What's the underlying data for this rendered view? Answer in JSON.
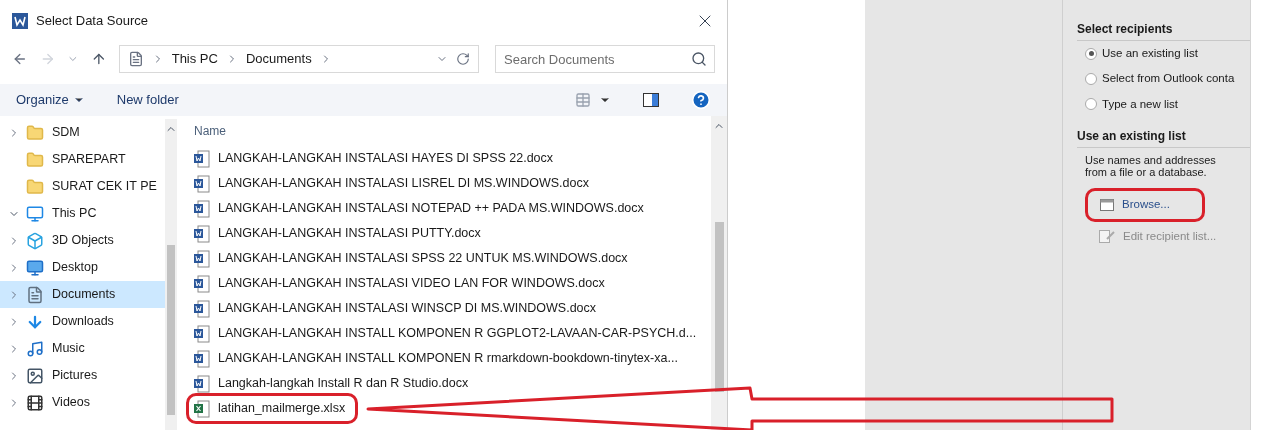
{
  "dialog": {
    "title": "Select Data Source",
    "breadcrumb": [
      "This PC",
      "Documents"
    ],
    "search": {
      "placeholder": "Search Documents"
    },
    "toolbar": {
      "organize": "Organize",
      "new_folder": "New folder"
    },
    "sidebar": [
      {
        "label": "SDM",
        "kind": "folder",
        "expandable": true,
        "selected": false
      },
      {
        "label": "SPAREPART",
        "kind": "folder",
        "expandable": false,
        "selected": false
      },
      {
        "label": "SURAT CEK IT PE",
        "kind": "folder",
        "expandable": false,
        "selected": false
      },
      {
        "label": "This PC",
        "kind": "pc",
        "expandable": true,
        "expanded": true,
        "selected": false,
        "children": [
          {
            "label": "3D Objects",
            "kind": "cube",
            "expandable": true,
            "selected": false
          },
          {
            "label": "Desktop",
            "kind": "desktop",
            "expandable": true,
            "selected": false
          },
          {
            "label": "Documents",
            "kind": "document",
            "expandable": true,
            "selected": true
          },
          {
            "label": "Downloads",
            "kind": "download",
            "expandable": true,
            "selected": false
          },
          {
            "label": "Music",
            "kind": "music",
            "expandable": true,
            "selected": false
          },
          {
            "label": "Pictures",
            "kind": "picture",
            "expandable": true,
            "selected": false
          },
          {
            "label": "Videos",
            "kind": "video",
            "expandable": true,
            "selected": false
          }
        ]
      }
    ],
    "column": "Name",
    "files": [
      {
        "name": "LANGKAH-LANGKAH INSTALASI HAYES DI SPSS 22.docx",
        "kind": "word"
      },
      {
        "name": "LANGKAH-LANGKAH INSTALASI LISREL DI MS.WINDOWS.docx",
        "kind": "word"
      },
      {
        "name": "LANGKAH-LANGKAH INSTALASI NOTEPAD ++ PADA MS.WINDOWS.docx",
        "kind": "word"
      },
      {
        "name": "LANGKAH-LANGKAH INSTALASI PUTTY.docx",
        "kind": "word"
      },
      {
        "name": "LANGKAH-LANGKAH INSTALASI SPSS 22 UNTUK MS.WINDOWS.docx",
        "kind": "word"
      },
      {
        "name": "LANGKAH-LANGKAH INSTALASI VIDEO LAN FOR WINDOWS.docx",
        "kind": "word"
      },
      {
        "name": "LANGKAH-LANGKAH INSTALASI WINSCP DI MS.WINDOWS.docx",
        "kind": "word"
      },
      {
        "name": "LANGKAH-LANGKAH INSTALL KOMPONEN R GGPLOT2-LAVAAN-CAR-PSYCH.d...",
        "kind": "word"
      },
      {
        "name": "LANGKAH-LANGKAH INSTALL KOMPONEN R rmarkdown-bookdown-tinytex-xa...",
        "kind": "word"
      },
      {
        "name": "Langkah-langkah Install R dan R Studio.docx",
        "kind": "word"
      },
      {
        "name": "latihan_mailmerge.xlsx",
        "kind": "excel"
      }
    ]
  },
  "mail_merge_pane": {
    "heading": "Select recipients",
    "options": [
      {
        "label": "Use an existing list",
        "selected": true
      },
      {
        "label": "Select from Outlook conta",
        "selected": false
      },
      {
        "label": "Type a new list",
        "selected": false
      }
    ],
    "section": "Use an existing list",
    "description": "Use names and addresses from a file or a database.",
    "browse": "Browse...",
    "edit": {
      "label": "Edit recipient list...",
      "disabled": true
    }
  }
}
